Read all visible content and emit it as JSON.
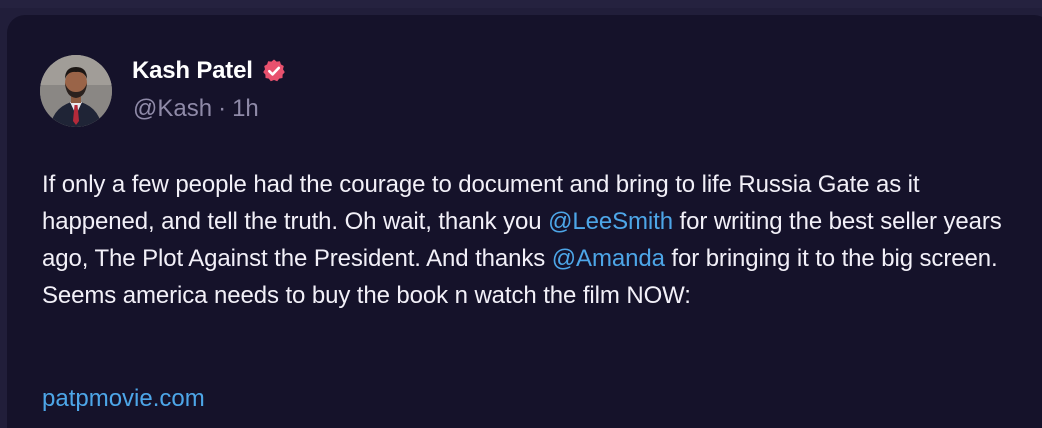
{
  "post": {
    "author_name": "Kash Patel",
    "handle": "@Kash",
    "separator": "·",
    "time": "1h",
    "text": {
      "part1": "If only a few people had the courage to document and bring to life Russia Gate as it happened, and tell the truth. Oh wait, thank you ",
      "mention1": "@LeeSmith",
      "part2": " for writing the best seller years ago, The Plot Against the President. And thanks ",
      "mention2": "@Amanda",
      "part3": " for bringing it to the big screen. Seems america needs to buy the book n watch the film NOW:"
    },
    "link": "patpmovie.com"
  },
  "icons": {
    "verified": "verified-badge-icon",
    "avatar": "profile-avatar"
  },
  "colors": {
    "card_background": "#15122a",
    "page_background": "#211e3a",
    "accent_link": "#4da6e8",
    "verified_badge": "#e8516e",
    "muted_text": "#8f8aa8"
  }
}
